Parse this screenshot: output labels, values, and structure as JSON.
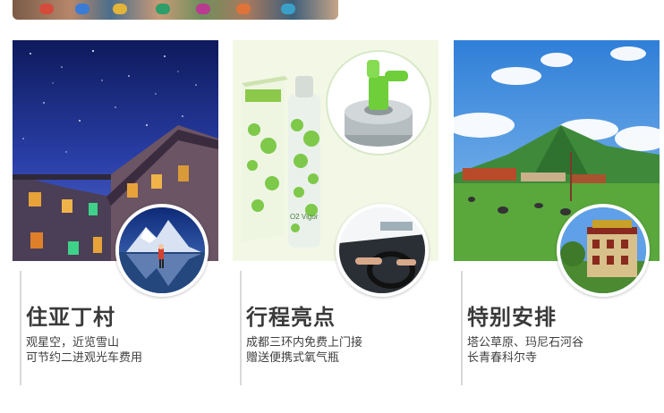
{
  "cards": [
    {
      "title": "住亚丁村",
      "lines": [
        "观星空，近览雪山",
        "可节约二进观光车费用"
      ]
    },
    {
      "title": "行程亮点",
      "lines": [
        "成都三环内免费上门接",
        "赠送便携式氧气瓶"
      ],
      "product_text": "O2 Vigor"
    },
    {
      "title": "特别安排",
      "lines": [
        "塔公草原、玛尼石河谷",
        "长青春科尔寺"
      ]
    }
  ],
  "colors": {
    "title": "#3a3a3a",
    "text": "#3f3f3f",
    "divider": "#d9d9d9",
    "night_sky": "#1b2a7a",
    "grass": "#4e9a3a",
    "oxygen_green": "#7ec84a"
  }
}
